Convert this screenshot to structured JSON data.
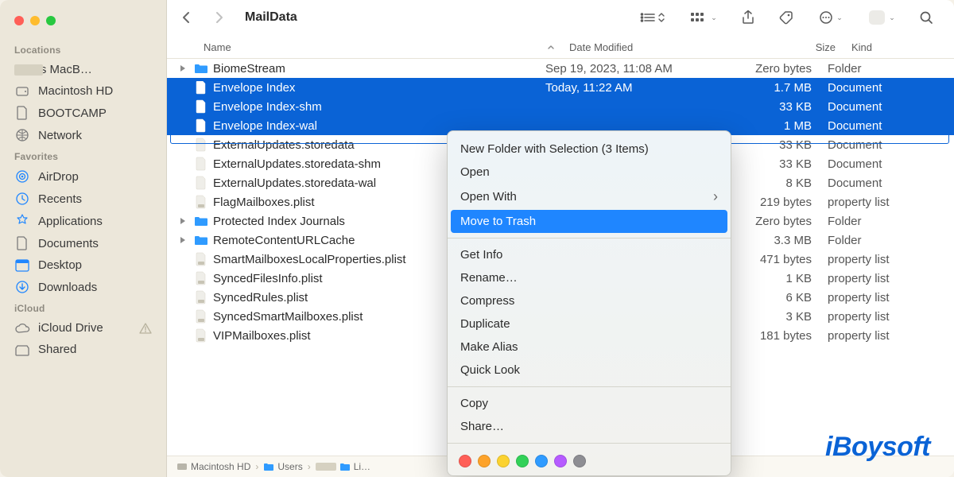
{
  "window": {
    "title": "MailData"
  },
  "sidebar": {
    "sections": [
      {
        "heading": "Locations",
        "items": [
          {
            "icon": "laptop-icon",
            "label": "'s MacB…",
            "masked": true
          },
          {
            "icon": "hdd-icon",
            "label": "Macintosh HD"
          },
          {
            "icon": "doc-icon",
            "label": "BOOTCAMP"
          },
          {
            "icon": "globe-icon",
            "label": "Network"
          }
        ]
      },
      {
        "heading": "Favorites",
        "items": [
          {
            "icon": "airdrop-icon",
            "label": "AirDrop"
          },
          {
            "icon": "clock-icon",
            "label": "Recents"
          },
          {
            "icon": "apps-icon",
            "label": "Applications"
          },
          {
            "icon": "doc-icon",
            "label": "Documents"
          },
          {
            "icon": "desktop-icon",
            "label": "Desktop"
          },
          {
            "icon": "download-icon",
            "label": "Downloads"
          }
        ]
      },
      {
        "heading": "iCloud",
        "items": [
          {
            "icon": "cloud-icon",
            "label": "iCloud Drive",
            "warn": true
          },
          {
            "icon": "shared-icon",
            "label": "Shared"
          }
        ]
      }
    ]
  },
  "columns": {
    "name": "Name",
    "date": "Date Modified",
    "size": "Size",
    "kind": "Kind"
  },
  "rows": [
    {
      "expandable": true,
      "type": "folder",
      "name": "BiomeStream",
      "date": "Sep 19, 2023, 11:08 AM",
      "size": "Zero bytes",
      "kind": "Folder",
      "selected": false
    },
    {
      "expandable": false,
      "type": "doc",
      "name": "Envelope Index",
      "date": "Today, 11:22 AM",
      "size": "1.7 MB",
      "kind": "Document",
      "selected": true
    },
    {
      "expandable": false,
      "type": "doc",
      "name": "Envelope Index-shm",
      "date": "",
      "size": "33 KB",
      "kind": "Document",
      "selected": true
    },
    {
      "expandable": false,
      "type": "doc",
      "name": "Envelope Index-wal",
      "date": "",
      "size": "1 MB",
      "kind": "Document",
      "selected": true
    },
    {
      "expandable": false,
      "type": "doc",
      "name": "ExternalUpdates.storedata",
      "date": "",
      "size": "33 KB",
      "kind": "Document",
      "selected": false
    },
    {
      "expandable": false,
      "type": "doc",
      "name": "ExternalUpdates.storedata-shm",
      "date": "",
      "size": "33 KB",
      "kind": "Document",
      "selected": false
    },
    {
      "expandable": false,
      "type": "doc",
      "name": "ExternalUpdates.storedata-wal",
      "date": "",
      "size": "8 KB",
      "kind": "Document",
      "selected": false
    },
    {
      "expandable": false,
      "type": "plist",
      "name": "FlagMailboxes.plist",
      "date": "",
      "size": "219 bytes",
      "kind": "property list",
      "selected": false
    },
    {
      "expandable": true,
      "type": "folder",
      "name": "Protected Index Journals",
      "date": "",
      "size": "Zero bytes",
      "kind": "Folder",
      "selected": false
    },
    {
      "expandable": true,
      "type": "folder",
      "name": "RemoteContentURLCache",
      "date": "",
      "size": "3.3 MB",
      "kind": "Folder",
      "selected": false
    },
    {
      "expandable": false,
      "type": "plist",
      "name": "SmartMailboxesLocalProperties.plist",
      "date": "",
      "size": "471 bytes",
      "kind": "property list",
      "selected": false
    },
    {
      "expandable": false,
      "type": "plist",
      "name": "SyncedFilesInfo.plist",
      "date": "",
      "size": "1 KB",
      "kind": "property list",
      "selected": false
    },
    {
      "expandable": false,
      "type": "plist",
      "name": "SyncedRules.plist",
      "date": "",
      "size": "6 KB",
      "kind": "property list",
      "selected": false
    },
    {
      "expandable": false,
      "type": "plist",
      "name": "SyncedSmartMailboxes.plist",
      "date": "",
      "size": "3 KB",
      "kind": "property list",
      "selected": false
    },
    {
      "expandable": false,
      "type": "plist",
      "name": "VIPMailboxes.plist",
      "date": "",
      "size": "181 bytes",
      "kind": "property list",
      "selected": false
    }
  ],
  "path": [
    "Macintosh HD",
    "Users",
    "",
    "Li…"
  ],
  "context_menu": {
    "items": [
      {
        "label": "New Folder with Selection (3 Items)"
      },
      {
        "label": "Open"
      },
      {
        "label": "Open With",
        "submenu": true
      },
      {
        "label": "Move to Trash",
        "highlight": true
      },
      {
        "divider_before": true,
        "label": "Get Info"
      },
      {
        "label": "Rename…"
      },
      {
        "label": "Compress"
      },
      {
        "label": "Duplicate"
      },
      {
        "label": "Make Alias"
      },
      {
        "label": "Quick Look"
      },
      {
        "divider_before": true,
        "label": "Copy"
      },
      {
        "label": "Share…"
      }
    ],
    "tag_colors": [
      "#ff5f57",
      "#fda32a",
      "#fbd230",
      "#32d158",
      "#2f9bff",
      "#b65bff",
      "#8e8e93"
    ]
  },
  "watermark": "iBoysoft"
}
